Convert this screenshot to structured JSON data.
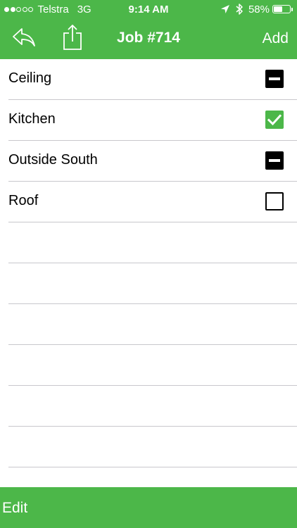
{
  "status_bar": {
    "carrier": "Telstra",
    "network": "3G",
    "time": "9:14 AM",
    "battery_percent": "58%",
    "battery_level": 0.58,
    "signal_bars_filled": 2,
    "signal_bars_total": 5
  },
  "nav": {
    "title": "Job #714",
    "add_label": "Add",
    "back_icon": "reply-arrow-icon",
    "share_icon": "share-icon"
  },
  "items": [
    {
      "label": "Ceiling",
      "state": "mixed"
    },
    {
      "label": "Kitchen",
      "state": "checked"
    },
    {
      "label": "Outside South",
      "state": "mixed"
    },
    {
      "label": "Roof",
      "state": "unchecked"
    }
  ],
  "toolbar": {
    "edit_label": "Edit"
  },
  "colors": {
    "accent": "#4cb749",
    "separator": "#c8c7cc",
    "checkbox_mixed": "#000000",
    "checkbox_checked": "#4cb749"
  }
}
